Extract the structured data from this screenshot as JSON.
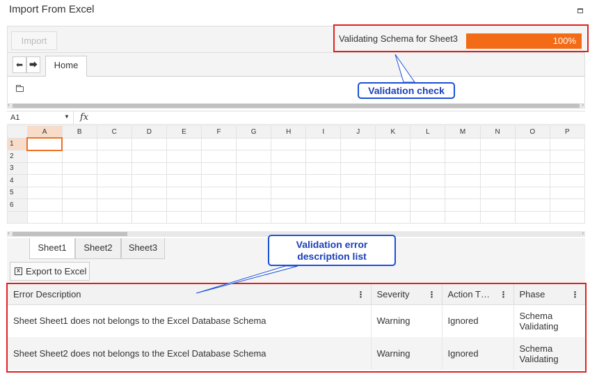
{
  "window": {
    "title": "Import From Excel"
  },
  "toolbar": {
    "import_label": "Import"
  },
  "progress": {
    "label": "Validating Schema for Sheet3",
    "percent": 100,
    "percent_label": "100%",
    "fill_color": "#f36b16"
  },
  "tabs": {
    "home_label": "Home"
  },
  "formula": {
    "cell_ref": "A1",
    "fx": "fx"
  },
  "grid": {
    "columns": [
      "A",
      "B",
      "C",
      "D",
      "E",
      "F",
      "G",
      "H",
      "I",
      "J",
      "K",
      "L",
      "M",
      "N",
      "O",
      "P"
    ],
    "rows": [
      "1",
      "2",
      "3",
      "4",
      "5",
      "6",
      ""
    ]
  },
  "sheets": [
    "Sheet1",
    "Sheet2",
    "Sheet3"
  ],
  "export": {
    "label": "Export to Excel"
  },
  "errors": {
    "headers": [
      "Error Description",
      "Severity",
      "Action T…",
      "Phase"
    ],
    "rows": [
      {
        "description": "Sheet Sheet1 does not belongs to the Excel Database Schema",
        "severity": "Warning",
        "action": "Ignored",
        "phase_line1": "Schema",
        "phase_line2": "Validating"
      },
      {
        "description": "Sheet Sheet2 does not belongs to the Excel Database Schema",
        "severity": "Warning",
        "action": "Ignored",
        "phase_line1": "Schema",
        "phase_line2": "Validating"
      }
    ]
  },
  "callouts": {
    "validation_check": "Validation check",
    "error_list_line1": "Validation error",
    "error_list_line2": "description list"
  },
  "colors": {
    "accent": "#f36b16",
    "highlight_border": "#e02020",
    "callout": "#1a4fd6"
  }
}
